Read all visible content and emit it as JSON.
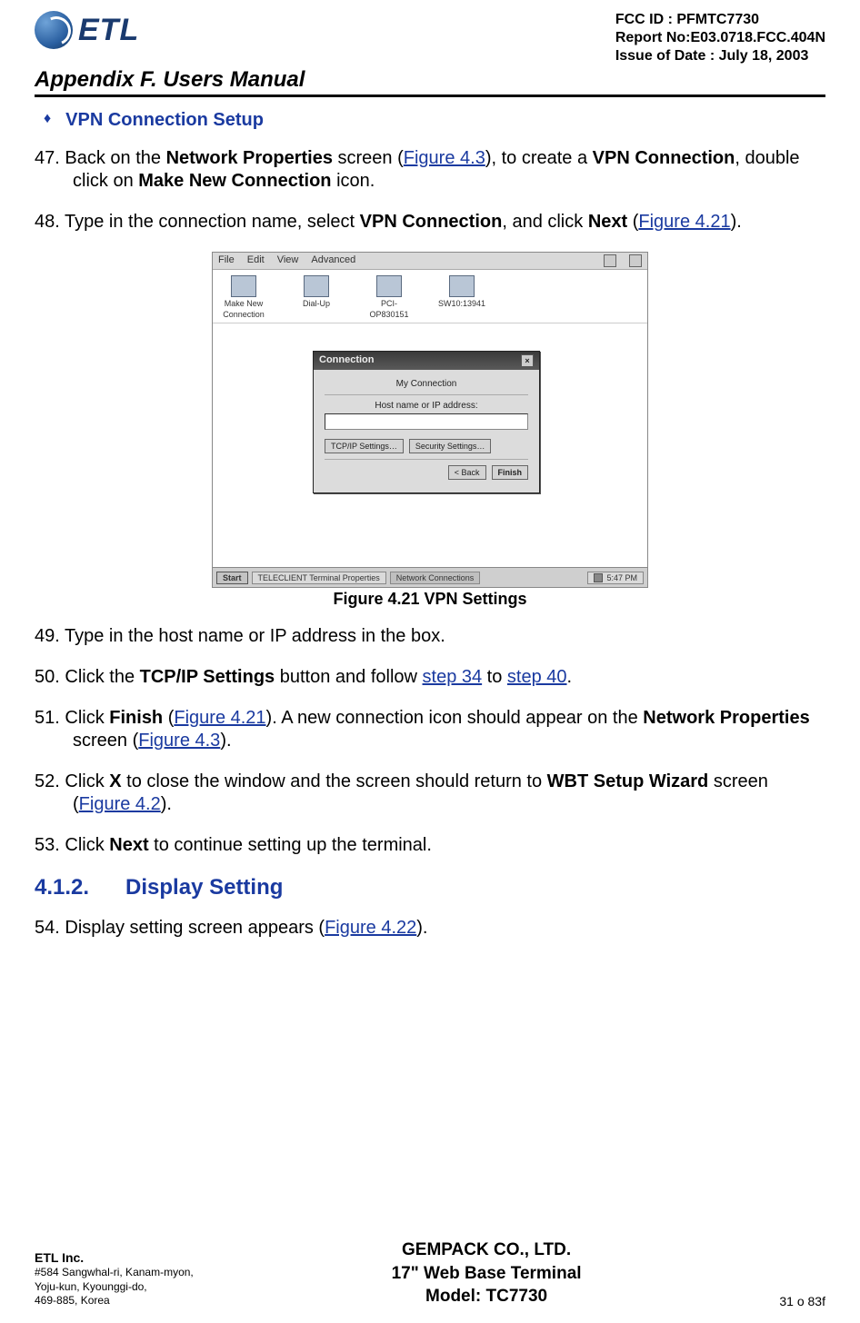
{
  "header": {
    "logo_text": "ETL",
    "meta_line1": "FCC ID : PFMTC7730",
    "meta_line2": "Report No:E03.0718.FCC.404N",
    "meta_line3": "Issue of Date : July 18, 2003",
    "appendix": "Appendix F.  Users Manual"
  },
  "section_bullet": "VPN Connection Setup",
  "steps": {
    "s47_num": "47.",
    "s47_a": "Back on the ",
    "s47_b": "Network Properties",
    "s47_c": " screen (",
    "s47_link1": "Figure 4.3",
    "s47_d": "), to create a ",
    "s47_e": "VPN Connection",
    "s47_f": ", double click on ",
    "s47_g": "Make New Connection",
    "s47_h": " icon.",
    "s48_num": "48.",
    "s48_a": "Type in the connection name, select ",
    "s48_b": "VPN Connection",
    "s48_c": ", and click ",
    "s48_d": "Next",
    "s48_e": " (",
    "s48_link": "Figure 4.21",
    "s48_f": ").",
    "s49_num": "49.",
    "s49_a": "Type in the host name or IP address in the box.",
    "s50_num": "50.",
    "s50_a": "Click the ",
    "s50_b": "TCP/IP Settings",
    "s50_c": " button and follow ",
    "s50_link1": "step 34",
    "s50_d": " to ",
    "s50_link2": "step 40",
    "s50_e": ".",
    "s51_num": "51.",
    "s51_a": "Click ",
    "s51_b": "Finish",
    "s51_c": " (",
    "s51_link1": "Figure 4.21",
    "s51_d": ").  A new connection icon should appear on the ",
    "s51_e": "Network Properties",
    "s51_f": " screen (",
    "s51_link2": "Figure 4.3",
    "s51_g": ").",
    "s52_num": "52.",
    "s52_a": "Click ",
    "s52_b": "X",
    "s52_c": " to close the window and the screen should return to ",
    "s52_d": "WBT Setup Wizard",
    "s52_e": " screen (",
    "s52_link": "Figure 4.2",
    "s52_f": ").",
    "s53_num": "53.",
    "s53_a": "Click ",
    "s53_b": "Next",
    "s53_c": " to continue setting up the terminal.",
    "s54_num": "54.",
    "s54_a": "Display setting screen appears (",
    "s54_link": "Figure 4.22",
    "s54_b": ")."
  },
  "figure": {
    "caption": "Figure 4.21       VPN Settings",
    "menubar": [
      "File",
      "Edit",
      "View",
      "Advanced"
    ],
    "icons": [
      {
        "label1": "Make New",
        "label2": "Connection"
      },
      {
        "label1": "Dial-Up",
        "label2": ""
      },
      {
        "label1": "PCI-",
        "label2": "OP830151"
      },
      {
        "label1": "SW10:13941",
        "label2": ""
      }
    ],
    "dialog": {
      "title": "Connection",
      "field1_label": "My Connection",
      "field2_label": "Host name or IP address:",
      "btn_tcp": "TCP/IP Settings…",
      "btn_sec": "Security Settings…",
      "btn_back": "< Back",
      "btn_finish": "Finish"
    },
    "taskbar": {
      "start": "Start",
      "task1": "TELECLIENT Terminal Properties",
      "task2": "Network Connections",
      "clock": "5:47 PM"
    }
  },
  "section2_num": "4.1.2.",
  "section2_title": "Display Setting",
  "footer": {
    "company": "ETL Inc.",
    "addr1": "#584 Sangwhal-ri, Kanam-myon,",
    "addr2": "Yoju-kun, Kyounggi-do,",
    "addr3": "469-885, Korea",
    "center1": "GEMPACK CO., LTD.",
    "center2": "17\" Web Base Terminal",
    "center3": "Model: TC7730",
    "page": "31 o 83f"
  }
}
